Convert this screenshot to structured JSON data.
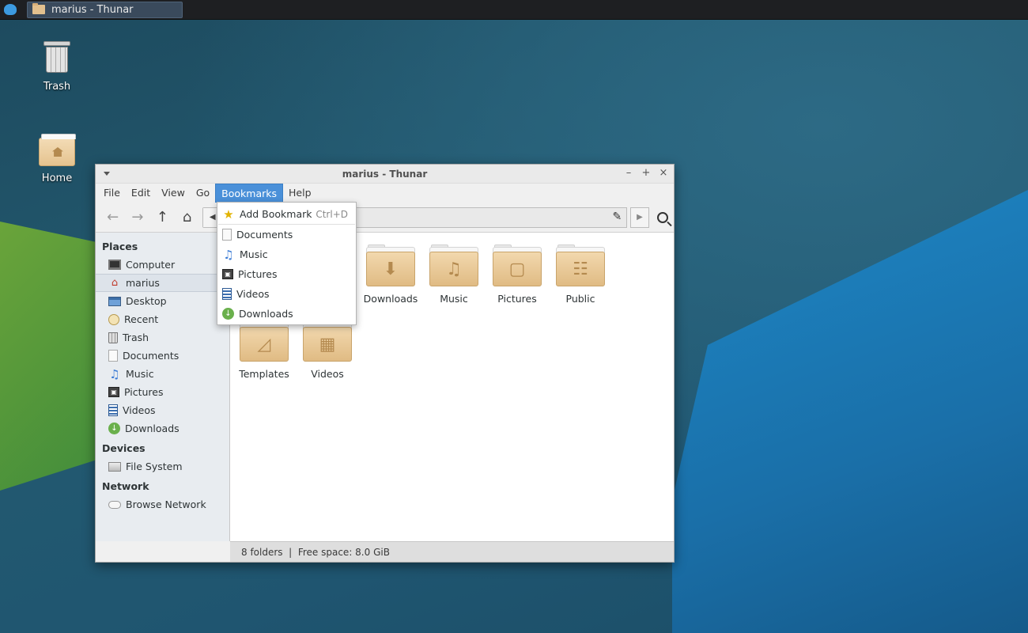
{
  "panel": {
    "task_title": "marius - Thunar"
  },
  "desktop": {
    "trash_label": "Trash",
    "home_label": "Home"
  },
  "window": {
    "title": "marius - Thunar",
    "menu": [
      "File",
      "Edit",
      "View",
      "Go",
      "Bookmarks",
      "Help"
    ],
    "active_menu": "Bookmarks"
  },
  "sidebar": {
    "places_header": "Places",
    "places": [
      "Computer",
      "marius",
      "Desktop",
      "Recent",
      "Trash",
      "Documents",
      "Music",
      "Pictures",
      "Videos",
      "Downloads"
    ],
    "selected": "marius",
    "devices_header": "Devices",
    "devices": [
      "File System"
    ],
    "network_header": "Network",
    "network": [
      "Browse Network"
    ]
  },
  "files": [
    {
      "name": "Downloads",
      "icon": "download-icon"
    },
    {
      "name": "Music",
      "icon": "music-note-icon"
    },
    {
      "name": "Pictures",
      "icon": "picture-icon"
    },
    {
      "name": "Public",
      "icon": "share-icon"
    },
    {
      "name": "Templates",
      "icon": "template-icon"
    },
    {
      "name": "Videos",
      "icon": "film-icon"
    }
  ],
  "statusbar": {
    "text": "8 folders  |  Free space: 8.0 GiB"
  },
  "bookmarks_menu": {
    "add_label": "Add Bookmark",
    "add_shortcut": "Ctrl+D",
    "items": [
      "Documents",
      "Music",
      "Pictures",
      "Videos",
      "Downloads"
    ]
  },
  "colors": {
    "menu_highlight": "#4a90d9",
    "folder": "#e5c38f"
  }
}
